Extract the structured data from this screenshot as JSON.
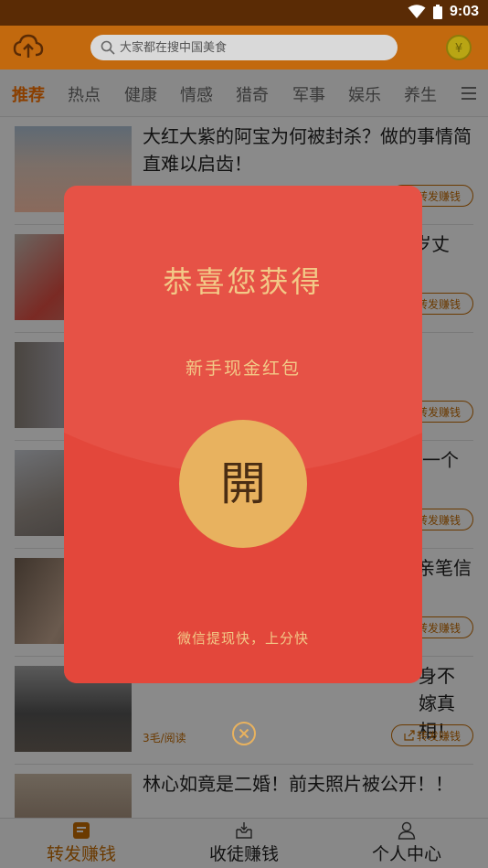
{
  "status_bar": {
    "time": "9:03"
  },
  "app_bar": {
    "search_placeholder": "大家都在搜中国美食",
    "coin_symbol": "¥"
  },
  "tabs": [
    {
      "label": "推荐",
      "active": true
    },
    {
      "label": "热点"
    },
    {
      "label": "健康"
    },
    {
      "label": "情感"
    },
    {
      "label": "猎奇"
    },
    {
      "label": "军事"
    },
    {
      "label": "娱乐"
    },
    {
      "label": "养生"
    }
  ],
  "feed": {
    "items": [
      {
        "title": "大红大紫的阿宝为何被封杀？做的事情简直难以启齿！",
        "meta": "",
        "share": "转发赚钱"
      },
      {
        "title": "岁丈",
        "meta": "",
        "share": "转发赚钱"
      },
      {
        "title": "",
        "meta": "",
        "share": "转发赚钱"
      },
      {
        "title": "一个",
        "meta": "",
        "share": "转发赚钱"
      },
      {
        "title": "亲笔信",
        "meta": "",
        "share": "转发赚钱"
      },
      {
        "title": "身不嫁真相！",
        "meta": "3毛/阅读",
        "share": "转发赚钱"
      },
      {
        "title": "林心如竟是二婚！前夫照片被公开！！",
        "meta": "",
        "share": ""
      }
    ]
  },
  "bottom_nav": [
    {
      "label": "转发赚钱",
      "icon": "share-doc-icon",
      "active": true
    },
    {
      "label": "收徒赚钱",
      "icon": "inbox-download-icon"
    },
    {
      "label": "个人中心",
      "icon": "person-icon"
    }
  ],
  "popup": {
    "title": "恭喜您获得",
    "subtitle": "新手现金红包",
    "open_label": "開",
    "footer": "微信提现快，上分快"
  },
  "colors": {
    "app_bar": "#c2690e",
    "popup_red": "#e65246",
    "popup_gold": "#f2c987",
    "open_button": "#e8b25f"
  }
}
